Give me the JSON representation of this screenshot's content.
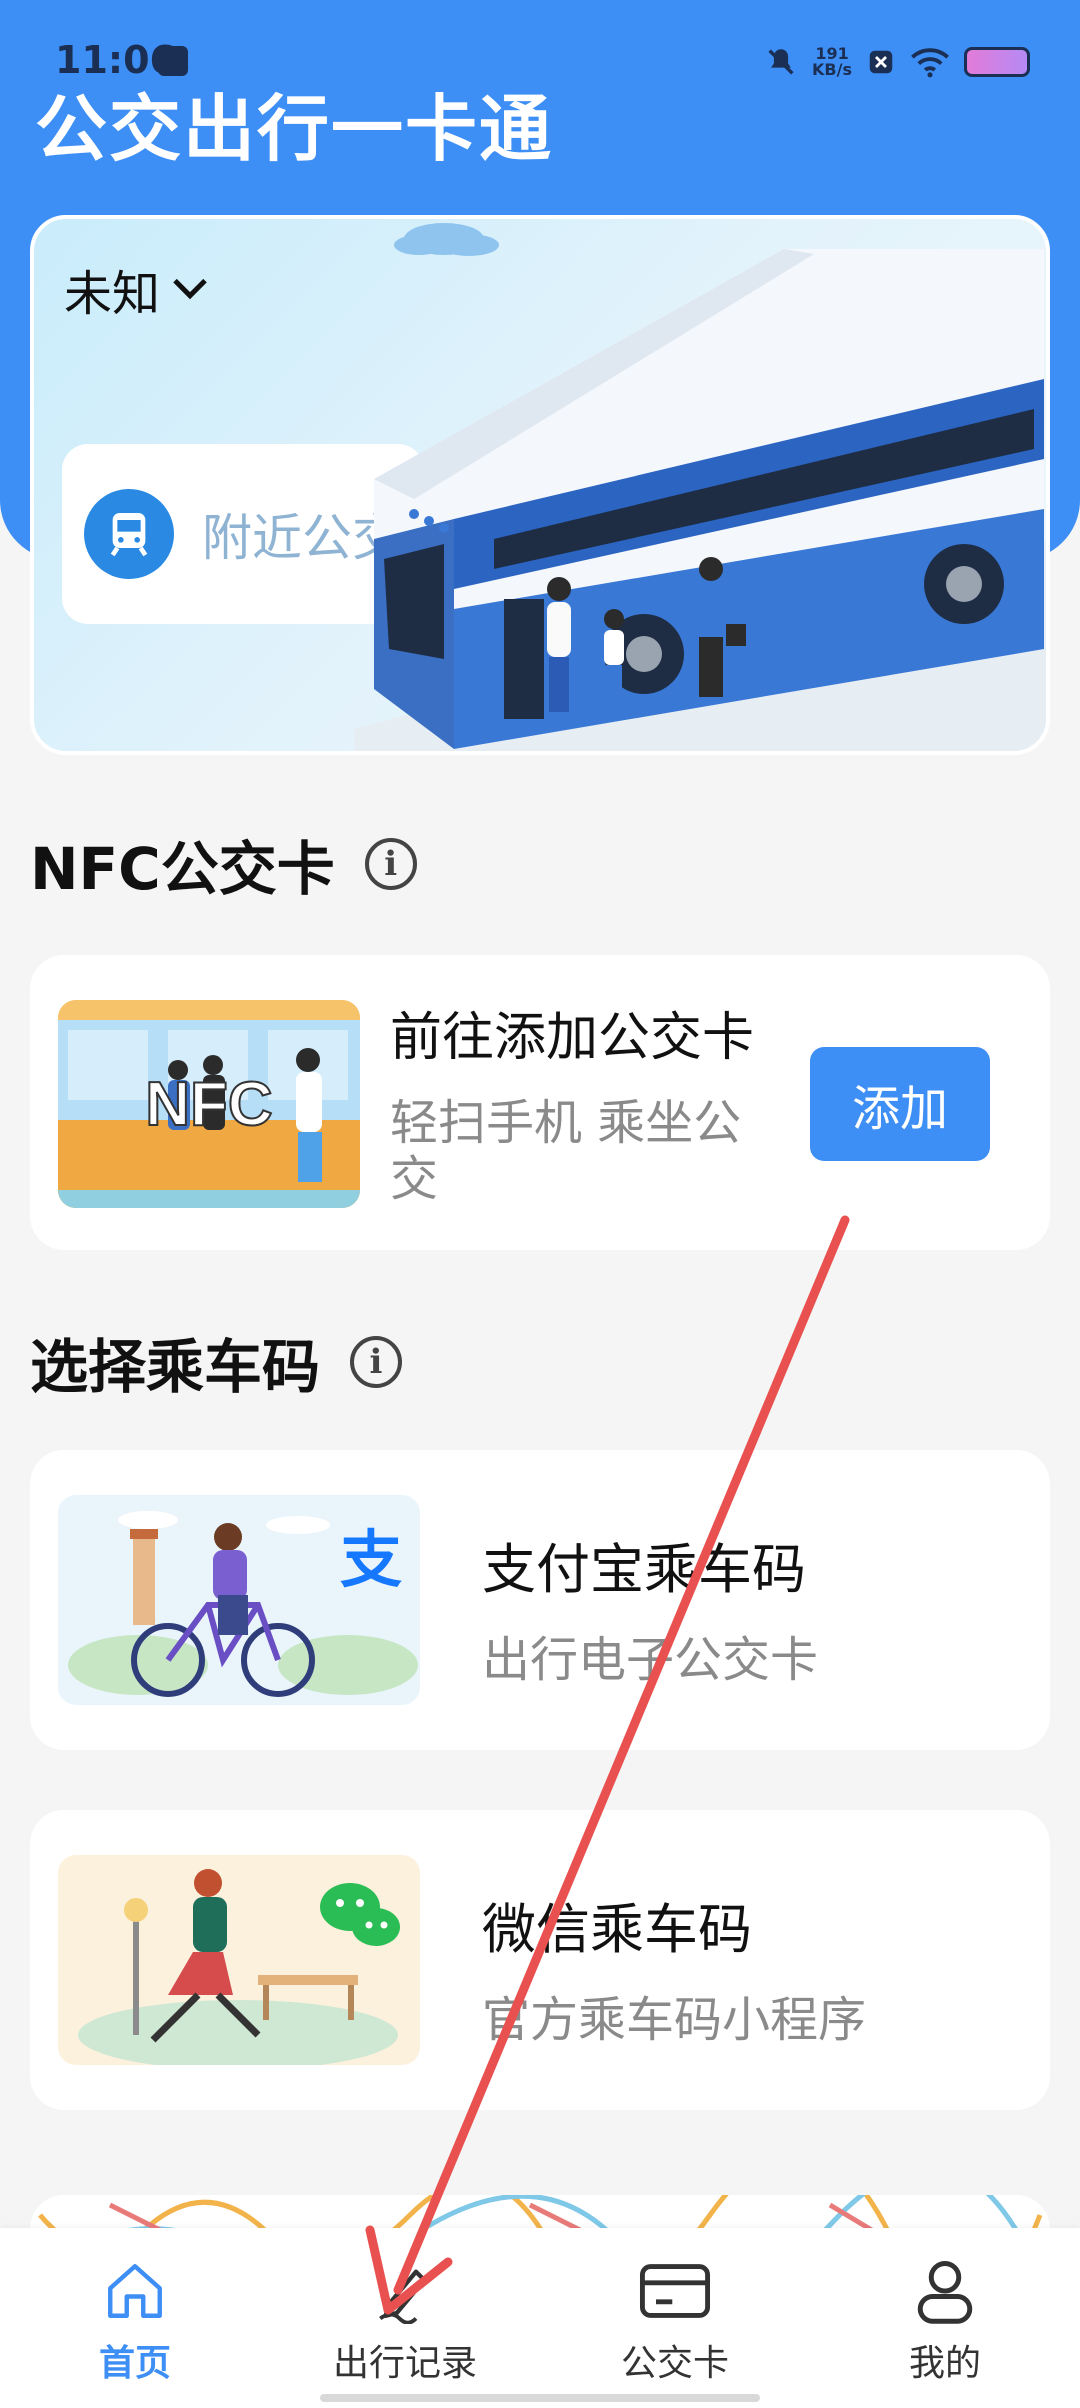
{
  "status_bar": {
    "time": "11:06",
    "network_speed": "191",
    "network_unit": "KB/s"
  },
  "app": {
    "title": "公交出行一卡通"
  },
  "banner": {
    "city": "未知",
    "nearby_label": "附近公交"
  },
  "nfc_section": {
    "title": "NFC公交卡",
    "card": {
      "thumb_text": "NFC",
      "title": "前往添加公交卡",
      "subtitle": "轻扫手机  乘坐公交",
      "button_label": "添加"
    }
  },
  "code_section": {
    "title": "选择乘车码",
    "items": [
      {
        "title": "支付宝乘车码",
        "subtitle": "出行电子公交卡",
        "logo_text": "支"
      },
      {
        "title": "微信乘车码",
        "subtitle": "官方乘车码小程序"
      }
    ]
  },
  "bottom_nav": {
    "items": [
      {
        "label": "首页",
        "icon": "home-icon",
        "active": true
      },
      {
        "label": "出行记录",
        "icon": "pen-icon",
        "active": false
      },
      {
        "label": "公交卡",
        "icon": "card-icon",
        "active": false
      },
      {
        "label": "我的",
        "icon": "person-icon",
        "active": false
      }
    ]
  },
  "colors": {
    "primary": "#3d8ef5",
    "header": "#3d8ef5",
    "annotation_arrow": "#e8514f"
  }
}
